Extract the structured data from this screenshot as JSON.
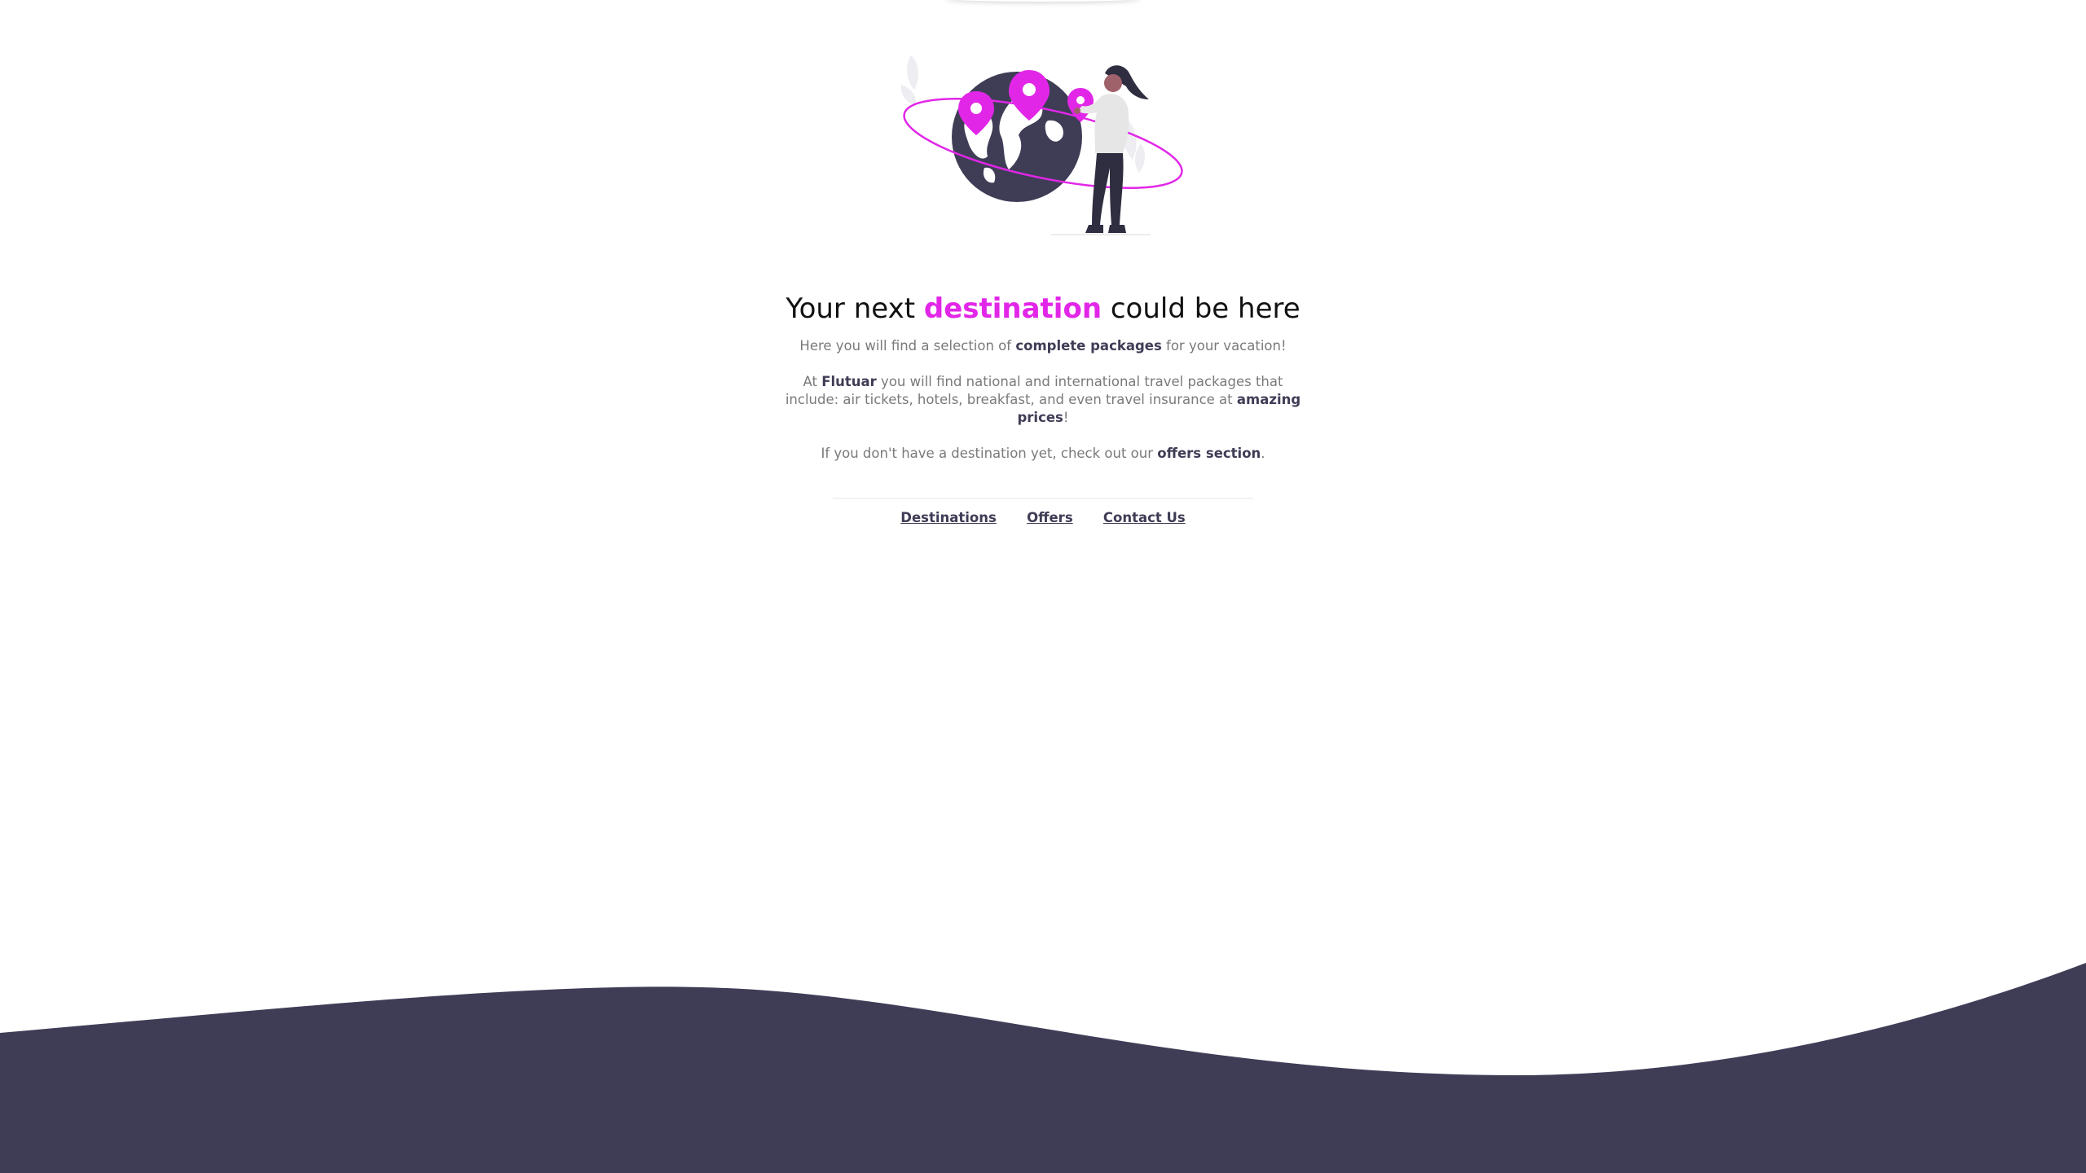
{
  "headline": {
    "before": "Your next ",
    "accent": "destination",
    "after": " could be here"
  },
  "intro": {
    "before": "Here you will find a selection of ",
    "strong": "complete packages",
    "after": " for your vacation!"
  },
  "about": {
    "before": "At ",
    "brand": "Flutuar",
    "middle": " you will find national and international travel packages that include: air tickets, hotels, breakfast, and even travel insurance at ",
    "strong": "amazing prices",
    "after": "!"
  },
  "offers_note": {
    "before": "If you don't have a destination yet, check out our ",
    "strong": "offers section",
    "after": "."
  },
  "nav": {
    "destinations": "Destinations",
    "offers": "Offers",
    "contact": "Contact Us"
  },
  "colors": {
    "accent": "#e226e8",
    "dark": "#3f3d56",
    "text_muted": "#7a7a7a"
  },
  "illustration": "woman-with-globe-and-map-pins"
}
